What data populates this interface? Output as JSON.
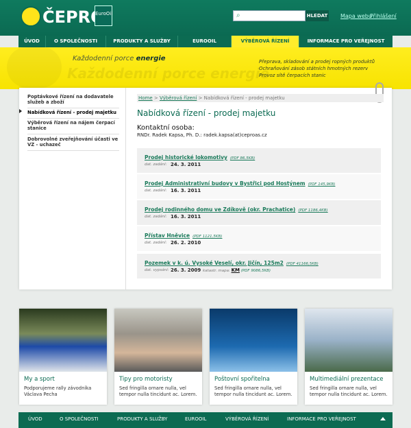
{
  "header": {
    "logo": "ČEPRO",
    "euro_logo": "EuroOil",
    "search_placeholder": "",
    "search_button": "HLEDAT",
    "links": [
      "Mapa webu",
      "Přihlášení"
    ]
  },
  "nav": [
    "ÚVOD",
    "O SPOLEČNOSTI",
    "PRODUKTY A SLUŽBY",
    "EUROOIL",
    "VÝBĚROVÁ ŘÍZENÍ",
    "INFORMACE PRO VEŘEJNOST"
  ],
  "nav_active_index": 4,
  "banner": {
    "slogan_plain": "Každodenní porce ",
    "slogan_bold": "energie",
    "slogan_ghost": "Každodenní porce energie",
    "info": [
      "Přeprava, skladování a prodej ropných produktů",
      "Ochraňování zásob státních hmotných rezerv",
      "Provoz sítě čerpacích stanic"
    ]
  },
  "sidebar": {
    "items": [
      "Poptávkové řízení na dodavatele služeb a zboží",
      "Nabídková řízení - prodej majetku",
      "Výběrová řízení na nájem čerpací stanice",
      "Dobrovolné zveřejňování účasti ve VZ - uchazeč"
    ]
  },
  "breadcrumb": {
    "home": "Home",
    "sep": " > ",
    "section": "Výběrová řízení",
    "current": "Nabídková řízení - prodej majetku"
  },
  "page_title": "Nabídková řízení - prodej majetku",
  "contact": {
    "heading": "Kontaktní osoba:",
    "person": "RNDr. Radek Kapsa, Ph. D.: radek.kapsa(at)ceproas.cz"
  },
  "offers": [
    {
      "title": "Prodej historické lokomotivy",
      "meta": "(PDF 86,5KB)",
      "date_label": "dat. zadání:",
      "date": "24. 3. 2011"
    },
    {
      "title": "Prodej Administrativní budovy v Bystřici pod Hostýnem",
      "meta": "(PDF 145,9KB)",
      "date_label": "dat. zadání:",
      "date": "16. 3. 2011"
    },
    {
      "title": "Prodej rodinného domu ve Zdíkově (okr. Prachatice)",
      "meta": "(PDF 1186,4KB)",
      "date_label": "dat. zadání:",
      "date": "16. 3. 2011"
    },
    {
      "title": "Přístav Hněvice",
      "meta": "(PDF 1121,5KB)",
      "date_label": "dat. zadání:",
      "date": "26. 2. 2010"
    },
    {
      "title": "Pozemek v k. ú. Vysoké Veselí, okr. Jičín, 125m2",
      "meta": "(PDF 41166,5KB)",
      "date_label": "dat. vypsání:",
      "date": "26. 3. 2009",
      "extra_label": "katastr. mapa:",
      "extra_link": "KM",
      "extra_meta": "(PDF 9086,5KB)"
    }
  ],
  "cards": [
    {
      "title": "My a sport",
      "text": "Podporujeme rally závodníka Václava Pecha"
    },
    {
      "title": "Tipy pro motoristy",
      "text": "Sed fringilla ornare nulla, vel tempor nulla tincidunt ac. Lorem."
    },
    {
      "title": "Poštovní spořitelna",
      "text": "Sed fringilla ornare nulla, vel tempor nulla tincidunt ac. Lorem."
    },
    {
      "title": "Multimediální prezentace",
      "text": "Sed fringilla ornare nulla, vel tempor nulla tincidunt ac. Lorem."
    }
  ],
  "footer": [
    "ÚVOD",
    "O SPOLEČNOSTI",
    "PRODUKTY A SLUŽBY",
    "EUROOIL",
    "VÝBĚROVÁ ŘÍZENÍ",
    "INFORMACE PRO VEŘEJNOST"
  ],
  "colors": {
    "brand_green": "#0b6a52",
    "brand_yellow": "#ffed1f",
    "link_green": "#1a7a5a"
  }
}
